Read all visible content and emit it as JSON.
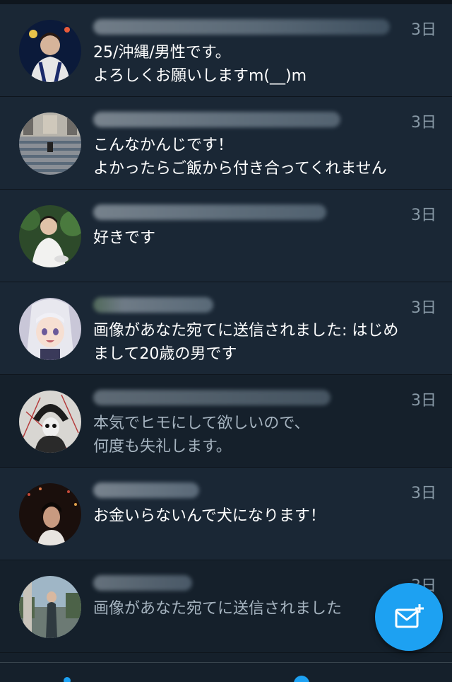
{
  "dm_list": {
    "conversations": [
      {
        "date": "3日",
        "message": "25/沖縄/男性です。\nよろしくお願いしますm(__)m",
        "read": false
      },
      {
        "date": "3日",
        "message": "こんなかんじです！\nよかったらご飯から付き合ってくれません",
        "read": false
      },
      {
        "date": "3日",
        "message": "好きです",
        "read": false
      },
      {
        "date": "3日",
        "message": "画像があなた宛てに送信されました: はじめ\nまして20歳の男です",
        "read": false
      },
      {
        "date": "3日",
        "message": "本気でヒモにして欲しいので、\n何度も失礼します。",
        "read": true
      },
      {
        "date": "3日",
        "message": "お金いらないんで犬になります！",
        "read": false
      },
      {
        "date": "3日",
        "message": "画像があなた宛てに送信されました",
        "read": true
      }
    ]
  },
  "fab": {
    "icon": "new-message-icon"
  },
  "colors": {
    "accent": "#1da1f2",
    "background": "#15202b",
    "unread_row": "#1a2735"
  }
}
